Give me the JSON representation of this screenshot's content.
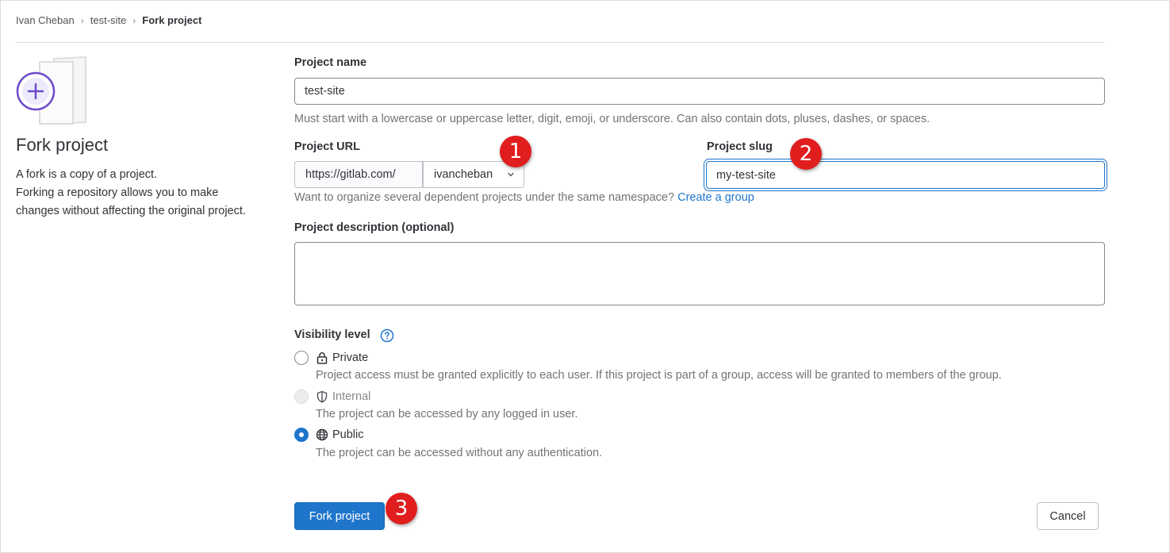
{
  "breadcrumb": {
    "items": [
      "Ivan Cheban",
      "test-site",
      "Fork project"
    ],
    "separator": "›"
  },
  "sidebar": {
    "title": "Fork project",
    "description": [
      "A fork is a copy of a project.",
      "Forking a repository allows you to make changes without affecting the original project."
    ]
  },
  "form": {
    "project_name": {
      "label": "Project name",
      "value": "test-site",
      "help": "Must start with a lowercase or uppercase letter, digit, emoji, or underscore. Can also contain dots, pluses, dashes, or spaces."
    },
    "project_url": {
      "label": "Project URL",
      "prefix": "https://gitlab.com/",
      "namespace": "ivancheban",
      "help": "Want to organize several dependent projects under the same namespace?",
      "help_link": "Create a group"
    },
    "project_slug": {
      "label": "Project slug",
      "value": "my-test-site"
    },
    "description": {
      "label": "Project description (optional)",
      "value": ""
    },
    "visibility": {
      "label": "Visibility level",
      "options": [
        {
          "label": "Private",
          "help": "Project access must be granted explicitly to each user. If this project is part of a group, access will be granted to members of the group.",
          "icon": "lock-icon",
          "checked": false,
          "disabled": false
        },
        {
          "label": "Internal",
          "help": "The project can be accessed by any logged in user.",
          "icon": "shield-icon",
          "checked": false,
          "disabled": true
        },
        {
          "label": "Public",
          "help": "The project can be accessed without any authentication.",
          "icon": "globe-icon",
          "checked": true,
          "disabled": false
        }
      ]
    },
    "submit_label": "Fork project",
    "cancel_label": "Cancel"
  },
  "annotations": [
    "1",
    "2",
    "3"
  ],
  "colors": {
    "primary": "#1f75cb",
    "marker": "#e01e1e",
    "illustration_accent": "#6e49cb"
  }
}
